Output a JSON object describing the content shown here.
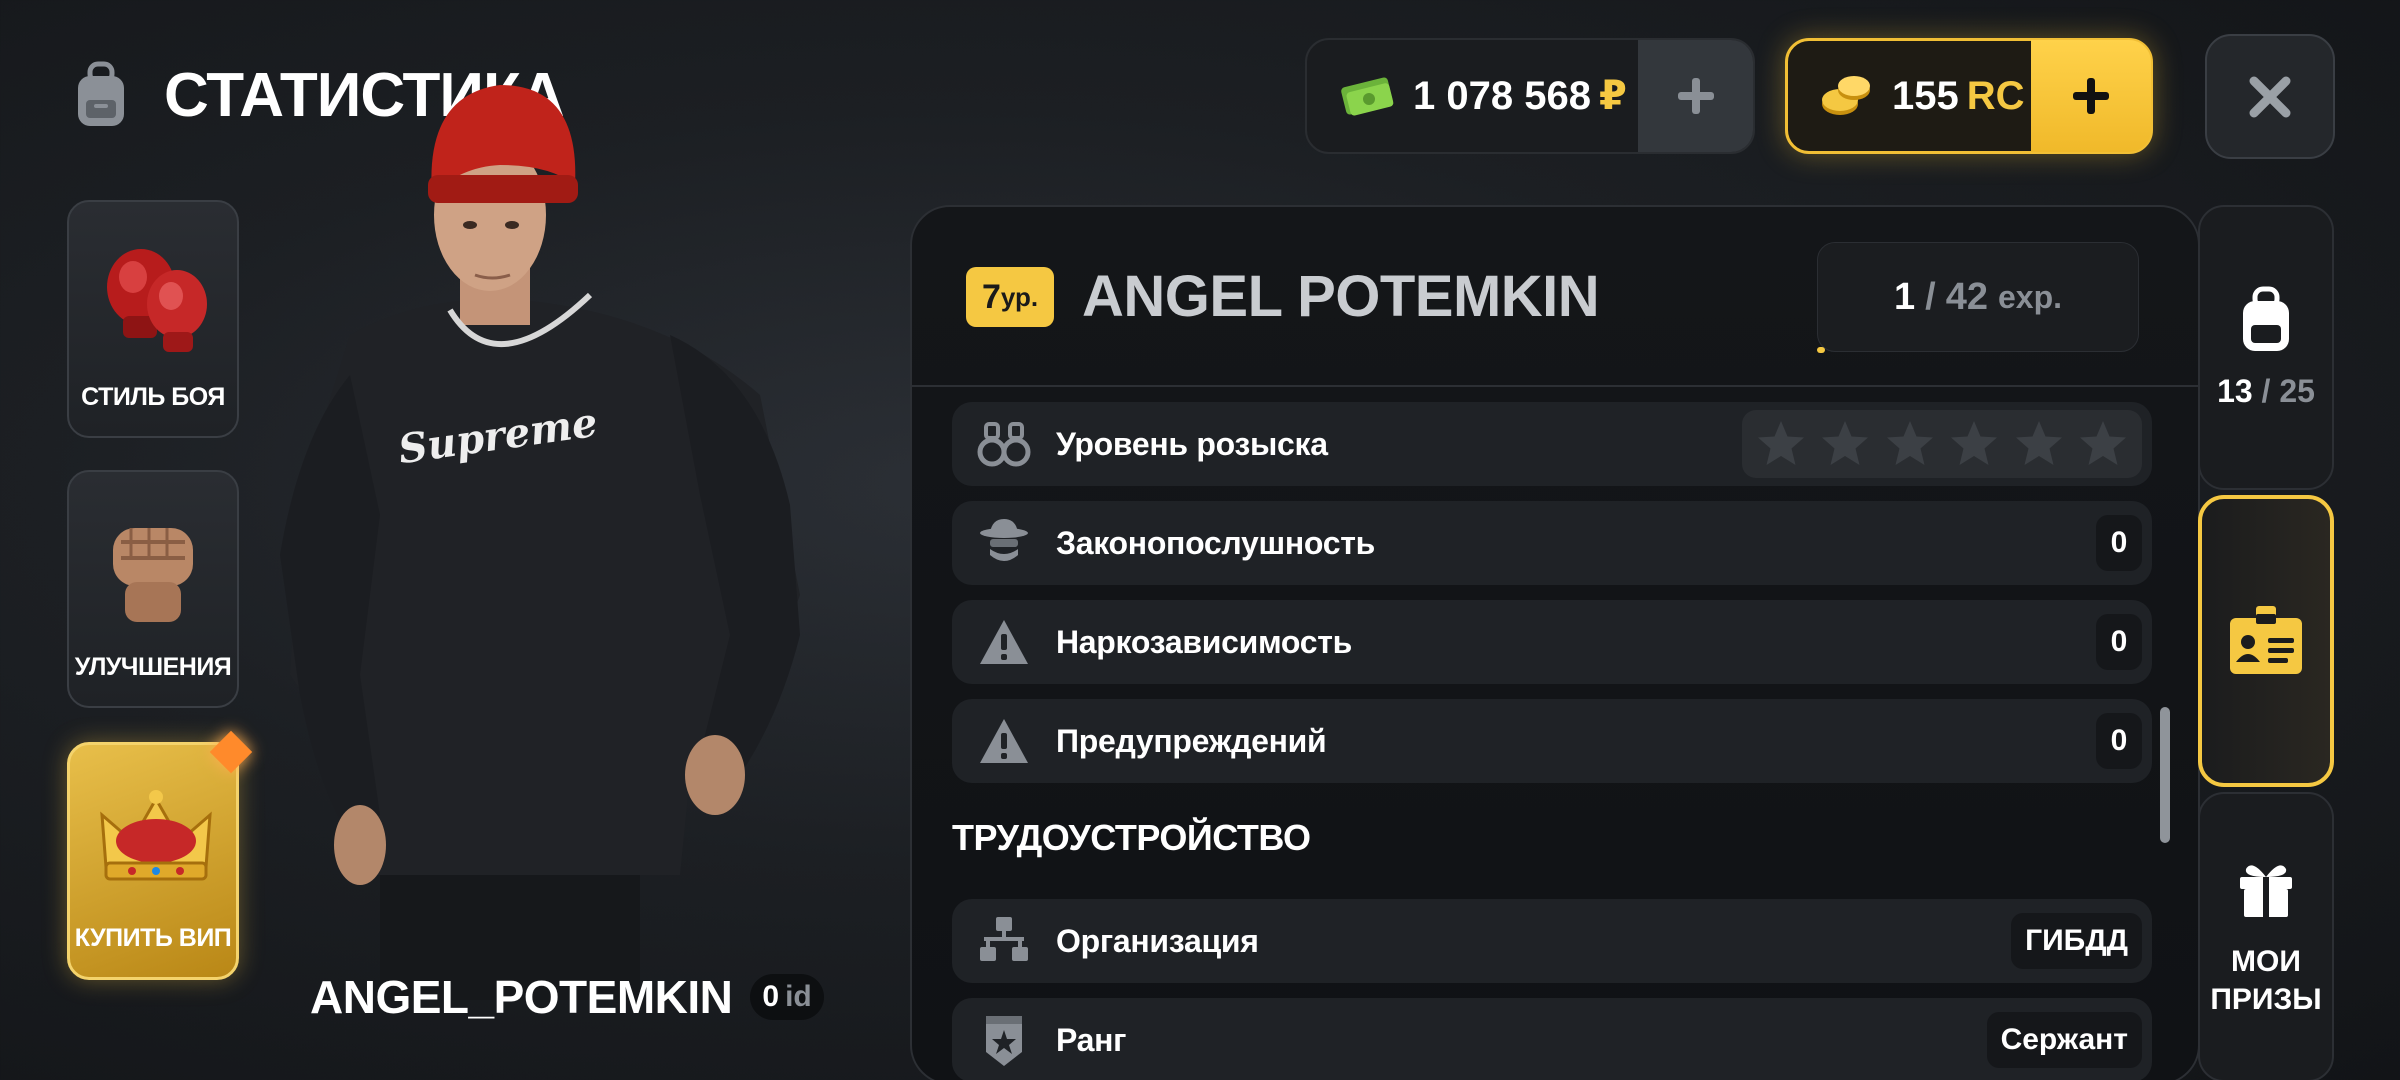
{
  "header": {
    "title": "СТАТИСТИКА",
    "icon": "backpack-icon"
  },
  "left_menu": [
    {
      "label": "СТИЛЬ БОЯ",
      "icon": "boxing-gloves-icon"
    },
    {
      "label": "УЛУЧШЕНИЯ",
      "icon": "fist-icon"
    },
    {
      "label": "КУПИТЬ ВИП",
      "icon": "crown-icon"
    }
  ],
  "character": {
    "name": "ANGEL_POTEMKIN",
    "id_value": "0",
    "id_label": "id",
    "shirt_text": "Supreme"
  },
  "currency": {
    "money": {
      "value": "1 078 568",
      "symbol": "₽",
      "icon": "cash-icon"
    },
    "rc": {
      "value": "155",
      "symbol": "RC",
      "icon": "coins-icon"
    },
    "plus_icon": "plus-icon",
    "close_icon": "close-icon"
  },
  "profile": {
    "level_value": "7",
    "level_unit": "ур.",
    "name": "ANGEL POTEMKIN",
    "exp_current": "1",
    "exp_sep": "/",
    "exp_max": "42",
    "exp_unit": "exp.",
    "exp_fraction": 0.024
  },
  "stats": [
    {
      "label": "Уровень розыска",
      "icon": "handcuffs-icon",
      "stars": 6,
      "filled_stars": 0
    },
    {
      "label": "Законопослушность",
      "value": "0",
      "icon": "agent-icon"
    },
    {
      "label": "Наркозависимость",
      "value": "0",
      "icon": "warning-icon"
    },
    {
      "label": "Предупреждений",
      "value": "0",
      "icon": "warning-icon"
    }
  ],
  "employment": {
    "title": "ТРУДОУСТРОЙСТВО",
    "rows": [
      {
        "label": "Организация",
        "value": "ГИБДД",
        "icon": "organization-icon"
      },
      {
        "label": "Ранг",
        "value": "Сержант",
        "icon": "rank-badge-icon"
      }
    ]
  },
  "tabs": {
    "inventory": {
      "icon": "backpack-icon",
      "count": "13",
      "sep": "/",
      "max": "25"
    },
    "passport": {
      "icon": "id-card-icon"
    },
    "prizes": {
      "icon": "gift-icon",
      "label_line1": "МОИ",
      "label_line2": "ПРИЗЫ"
    }
  },
  "colors": {
    "accent": "#f5c842",
    "background": "#1c1f23",
    "row": "#1f2226",
    "muted": "#8a8f96"
  }
}
